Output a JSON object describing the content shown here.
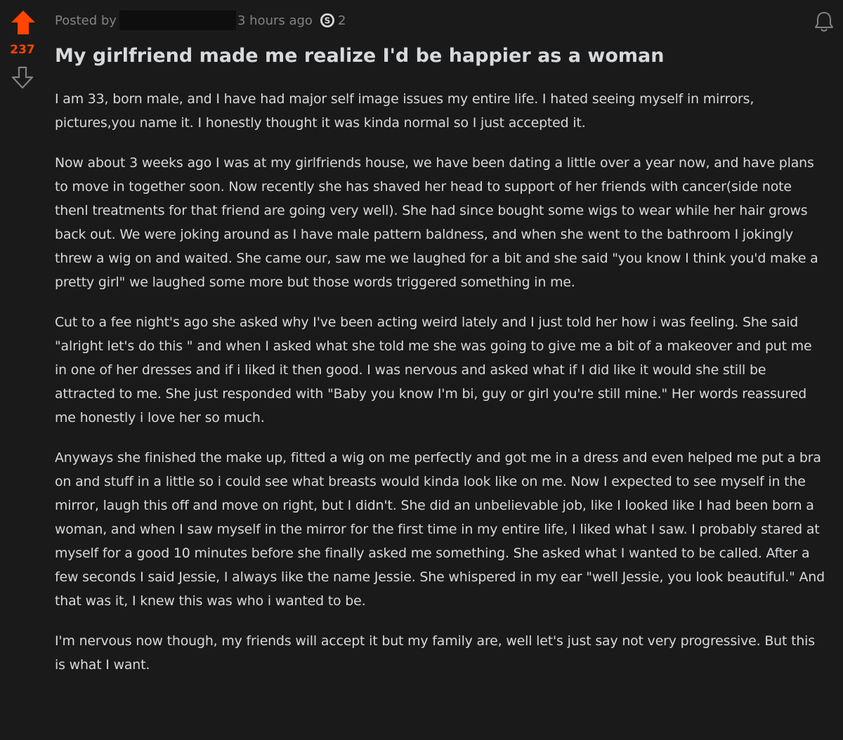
{
  "post": {
    "posted_by_label": "Posted by",
    "time_ago": "3 hours ago",
    "award_count": "2",
    "score": "237",
    "title": "My girlfriend made me realize I'd be happier as a woman",
    "paragraphs": [
      "I am 33, born male, and I have had major self image issues my entire life. I hated seeing myself in mirrors, pictures,you name it. I honestly thought it was kinda normal so I just accepted it.",
      "Now about 3 weeks ago I was at my girlfriends house, we have been dating a little over a year now, and have plans to move in together soon. Now recently she has shaved her head to support of her friends with cancer(side note thenl treatments for that friend are going very well). She had since bought some wigs to wear while her hair grows back out. We were joking around as I have male pattern baldness, and when she went to the bathroom I jokingly threw a wig on and waited. She came our, saw me we laughed for a bit and she said \"you know I think you'd make a pretty girl\" we laughed some more but those words triggered something in me.",
      "Cut to a fee night's ago she asked why I've been acting weird lately and I just told her how i was feeling. She said \"alright let's do this \" and when I asked what she told me she was going to give me a bit of a makeover and put me in one of her dresses and if i liked it then good. I was nervous and asked what if I did like it would she still be attracted to me. She just responded with \"Baby you know I'm bi, guy or girl you're still mine.\" Her words reassured me honestly i love her so much.",
      "Anyways she finished the make up, fitted a wig on me perfectly and got me in a dress and even helped me put a bra on and stuff in a little so i could see what breasts would kinda look like on me. Now I expected to see myself in the mirror, laugh this off and move on right, but I didn't. She did an unbelievable job, like I looked like I had been born a woman, and when I saw myself in the mirror for the first time in my entire life, I liked what I saw. I probably stared at myself for a good 10 minutes before she finally asked me something. She asked what I wanted to be called. After a few seconds I said Jessie, I always like the name Jessie. She whispered in my ear \"well Jessie, you look beautiful.\" And that was it, I knew this was who i wanted to be.",
      "I'm nervous now though, my friends will accept it but my family are, well let's just say not very progressive. But this is what I want."
    ]
  },
  "icons": {
    "upvote": "upvote-arrow-icon",
    "downvote": "downvote-arrow-icon",
    "coin": "silver-coin-icon",
    "bell": "bell-icon"
  },
  "colors": {
    "background": "#1a1a1b",
    "upvote_active": "#ff4500",
    "text": "#d7dadc",
    "meta_text": "#818384"
  }
}
